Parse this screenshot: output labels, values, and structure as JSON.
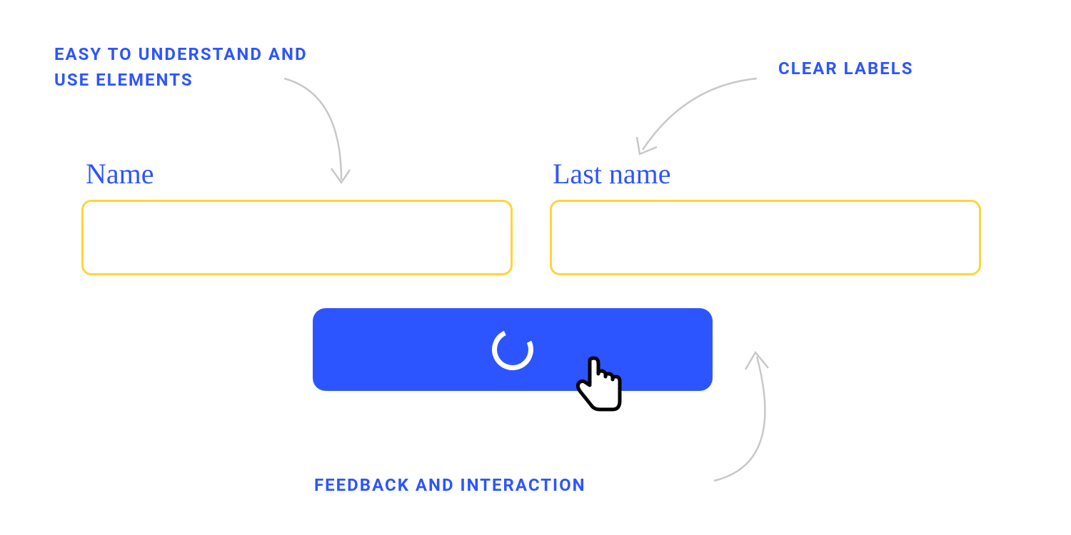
{
  "annotations": {
    "easy_elements": "EASY TO UNDERSTAND AND USE ELEMENTS",
    "clear_labels": "CLEAR LABELS",
    "feedback_interaction": "FEEDBACK AND INTERACTION"
  },
  "form": {
    "name_label": "Name",
    "lastname_label": "Last name",
    "name_value": "",
    "lastname_value": "",
    "name_placeholder": "",
    "lastname_placeholder": ""
  },
  "button": {
    "state": "loading"
  },
  "colors": {
    "accent_blue": "#2d55ff",
    "input_border": "#ffd43b",
    "spinner": "#ffffff"
  }
}
